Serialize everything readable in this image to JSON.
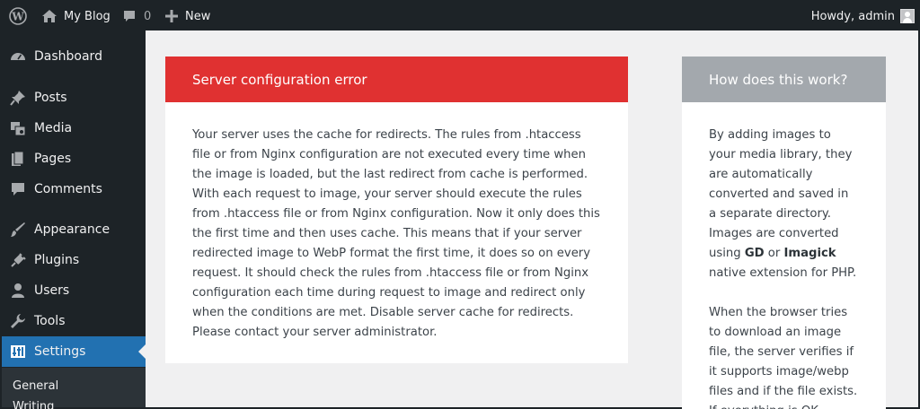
{
  "adminbar": {
    "site_name": "My Blog",
    "comments_count": "0",
    "new_label": "New",
    "howdy": "Howdy, admin"
  },
  "sidebar": {
    "items": [
      {
        "label": "Dashboard",
        "icon": "dashboard-icon"
      },
      {
        "label": "Posts",
        "icon": "pin-icon"
      },
      {
        "label": "Media",
        "icon": "media-icon"
      },
      {
        "label": "Pages",
        "icon": "pages-icon"
      },
      {
        "label": "Comments",
        "icon": "comment-icon"
      },
      {
        "label": "Appearance",
        "icon": "brush-icon"
      },
      {
        "label": "Plugins",
        "icon": "plug-icon"
      },
      {
        "label": "Users",
        "icon": "users-icon"
      },
      {
        "label": "Tools",
        "icon": "wrench-icon"
      },
      {
        "label": "Settings",
        "icon": "settings-icon",
        "active": true
      }
    ],
    "submenu": [
      "General",
      "Writing"
    ]
  },
  "error_box": {
    "title": "Server configuration error",
    "body": "Your server uses the cache for redirects. The rules from .htaccess file or from Nginx configuration are not executed every time when the image is loaded, but the last redirect from cache is performed. With each request to image, your server should execute the rules from .htaccess file or from Nginx configuration. Now it only does this the first time and then uses cache. This means that if your server redirected image to WebP format the first time, it does so on every request. It should check the rules from .htaccess file or from Nginx configuration each time during request to image and redirect only when the conditions are met. Disable server cache for redirects. Please contact your server administrator."
  },
  "info_box": {
    "title": "How does this work?",
    "p1_a": "By adding images to your media library, they are automatically converted and saved in a separate directory. Images are converted using ",
    "p1_gd": "GD",
    "p1_or": " or ",
    "p1_imagick": "Imagick",
    "p1_b": " native extension for PHP.",
    "p2": "When the browser tries to download an image file, the server verifies if it supports image/webp files and if the file exists. If everything is OK,"
  },
  "colors": {
    "adminbar_bg": "#1d2327",
    "active_menu": "#2271b1",
    "error_header": "#e03131",
    "info_header": "#a3a8ad"
  }
}
